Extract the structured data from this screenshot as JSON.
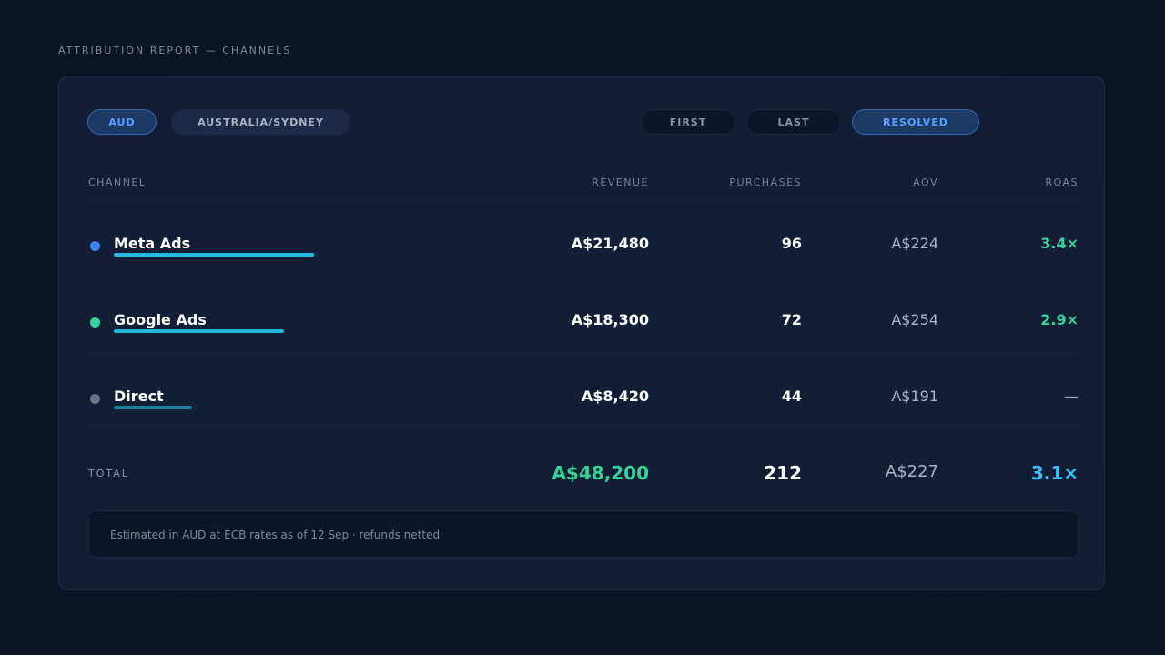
{
  "page_title": "ATTRIBUTION REPORT — CHANNELS",
  "filters": {
    "currency": "AUD",
    "timezone": "AUSTRALIA/SYDNEY",
    "attribution_modes": [
      "FIRST",
      "LAST",
      "RESOLVED"
    ],
    "selected_mode": "RESOLVED"
  },
  "columns": [
    "CHANNEL",
    "REVENUE",
    "PURCHASES",
    "AOV",
    "ROAS"
  ],
  "rows": [
    {
      "channel": "Meta Ads",
      "revenue": "A$21,480",
      "purchases": "96",
      "aov": "A$224",
      "roas": "3.4×",
      "dot_color": "#3b82f6",
      "bar_color": "#22b8d8",
      "bar_share": 0.446
    },
    {
      "channel": "Google Ads",
      "revenue": "A$18,300",
      "purchases": "72",
      "aov": "A$254",
      "roas": "2.9×",
      "dot_color": "#34d399",
      "bar_color": "#22b8d8",
      "bar_share": 0.38
    },
    {
      "channel": "Direct",
      "revenue": "A$8,420",
      "purchases": "44",
      "aov": "A$191",
      "roas": "—",
      "dot_color": "#6b7280",
      "bar_color": "#1b7f9a",
      "bar_share": 0.175
    }
  ],
  "total": {
    "label": "TOTAL",
    "revenue": "A$48,200",
    "purchases": "212",
    "aov": "A$227",
    "roas": "3.1×"
  },
  "note": "Estimated in AUD at ECB rates as of 12 Sep · refunds netted",
  "colors": {
    "accent_blue": "#5aa2ff",
    "positive_green": "#34d399",
    "total_roas": "#38bdf8"
  }
}
